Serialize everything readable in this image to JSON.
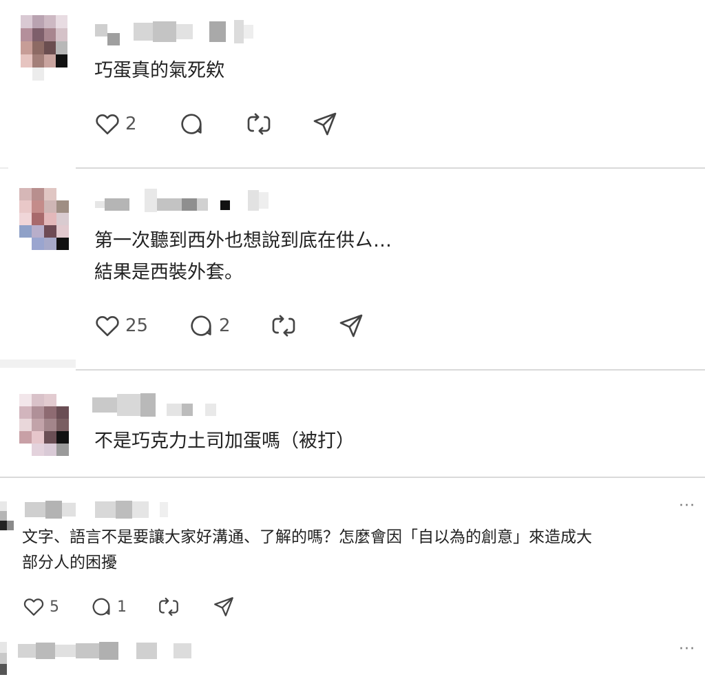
{
  "posts": [
    {
      "text_lines": [
        "巧蛋真的氣死欸"
      ],
      "likes": "2",
      "replies": "",
      "more": ""
    },
    {
      "text_lines": [
        "第一次聽到西外也想說到底在供ㄙ…",
        "結果是西裝外套。"
      ],
      "likes": "25",
      "replies": "2",
      "more": ""
    },
    {
      "text_lines": [
        "不是巧克力土司加蛋嗎（被打）"
      ],
      "likes": "",
      "replies": "",
      "more": ""
    },
    {
      "text_lines": [
        "文字、語言不是要讓大家好溝通、了解的嗎？怎麼會因「自以為的創意」來造成大",
        "部分人的困擾"
      ],
      "likes": "5",
      "replies": "1",
      "more": "···"
    },
    {
      "text_lines": [
        ""
      ],
      "likes": "",
      "replies": "",
      "more": "···"
    }
  ],
  "icons": {
    "like": "heart-icon",
    "reply": "comment-bubble-icon",
    "repost": "repost-icon",
    "share": "send-icon"
  },
  "colors": {
    "background": "#ffffff",
    "text": "#222222",
    "icon": "#444444",
    "divider": "#d9d9d9"
  }
}
